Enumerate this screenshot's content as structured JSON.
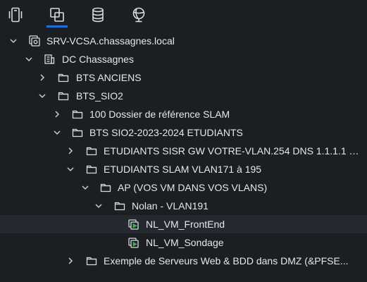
{
  "toolbar": {
    "tabs": [
      {
        "icon": "hosts-and-clusters-icon",
        "active": false
      },
      {
        "icon": "vms-and-templates-icon",
        "active": true
      },
      {
        "icon": "storage-icon",
        "active": false
      },
      {
        "icon": "networking-icon",
        "active": false
      }
    ]
  },
  "tree": {
    "vcenter": "SRV-VCSA.chassagnes.local",
    "datacenter": "DC Chassagnes",
    "bts_anciens": "BTS ANCIENS",
    "bts_sio2": "BTS_SIO2",
    "dossier_ref": "100 Dossier de référence SLAM",
    "etudiants_2023": "BTS SIO2-2023-2024 ETUDIANTS",
    "sisr": "ETUDIANTS SISR GW VOTRE-VLAN.254 DNS 1.1.1.1 &...",
    "slam": "ETUDIANTS SLAM VLAN171 à 195",
    "ap": "AP (VOS VM DANS VOS VLANS)",
    "nolan": "Nolan - VLAN191",
    "vm_frontend": "NL_VM_FrontEnd",
    "vm_sondage": "NL_VM_Sondage",
    "exemple": "Exemple de Serveurs Web & BDD dans DMZ (&PFSE..."
  },
  "colors": {
    "background": "#1b1e22",
    "selected_row": "#24292f",
    "active_tab_underline": "#1f6fd6",
    "vm_running": "#3cb44b"
  }
}
